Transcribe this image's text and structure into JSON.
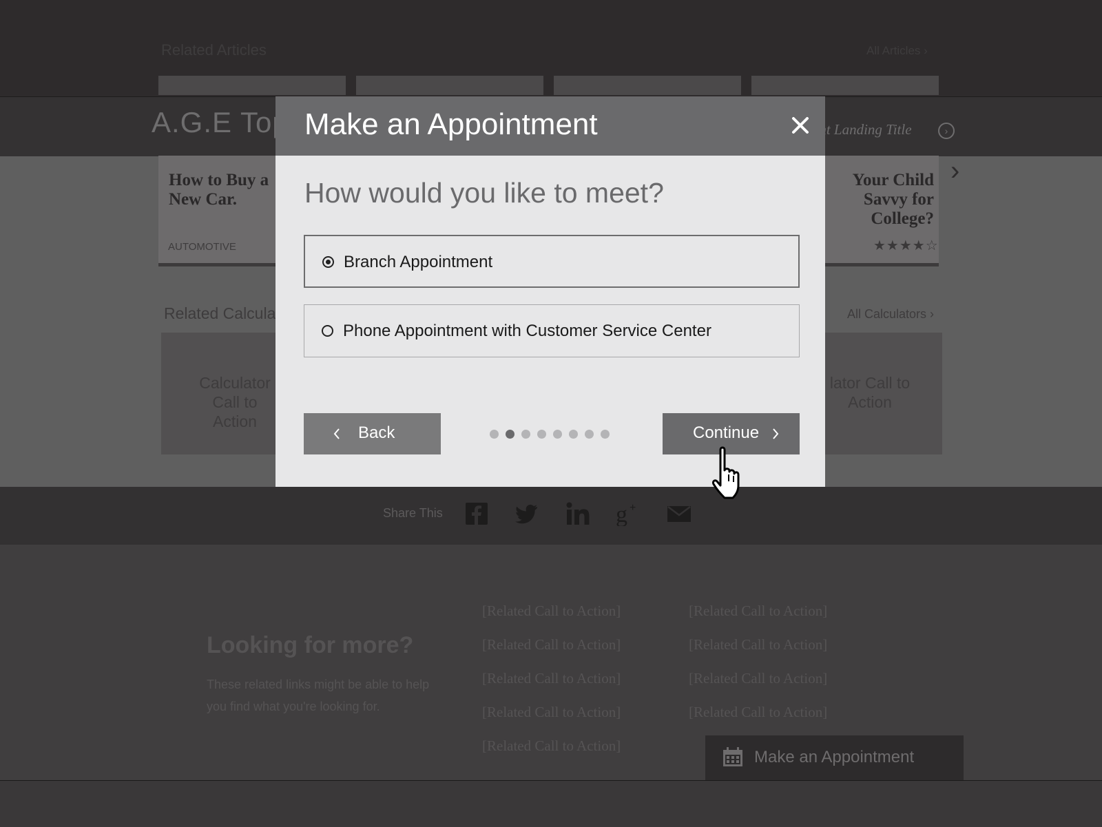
{
  "background": {
    "related_articles_title": "Related Articles",
    "all_articles_link": "All Articles ›",
    "section_title": "A.G.E Top",
    "landing_title": "ent Landing Title",
    "cards": [
      {
        "title": "How to Buy a New Car.",
        "category": "AUTOMOTIVE"
      },
      {
        "title": "Your Child Savvy for College?",
        "rating": "3.5 of 5 stars"
      }
    ],
    "related_calculators_title": "Related Calcula",
    "all_calculators_link": "All Calculators ›",
    "calc_cta_left": "Calculator Call to Action",
    "calc_cta_right": "lator Call to Action",
    "share_label": "Share This",
    "share_icons": [
      "facebook-icon",
      "twitter-icon",
      "linkedin-icon",
      "google-plus-icon",
      "mail-icon"
    ],
    "looking_title": "Looking for more?",
    "looking_text": "These related links might be able to help you find what you're looking for.",
    "cta_col1": [
      "[Related Call to Action]",
      "[Related Call to Action]",
      "[Related Call to Action]",
      "[Related Call to Action]",
      "[Related Call to Action]"
    ],
    "cta_col2": [
      "[Related Call to Action]",
      "[Related Call to Action]",
      "[Related Call to Action]",
      "[Related Call to Action]"
    ],
    "appointment_button": "Make an Appointment"
  },
  "modal": {
    "title": "Make an Appointment",
    "close_icon": "close-icon",
    "question": "How would you like to meet?",
    "options": [
      {
        "label": "Branch Appointment",
        "selected": true
      },
      {
        "label": "Phone Appointment with Customer Service Center",
        "selected": false
      }
    ],
    "back_label": "Back",
    "continue_label": "Continue",
    "step_total": 8,
    "step_current": 2
  },
  "colors": {
    "header": "#6a6a6c",
    "modal_bg": "#e7e7e8",
    "button": "#7a7a7b"
  }
}
